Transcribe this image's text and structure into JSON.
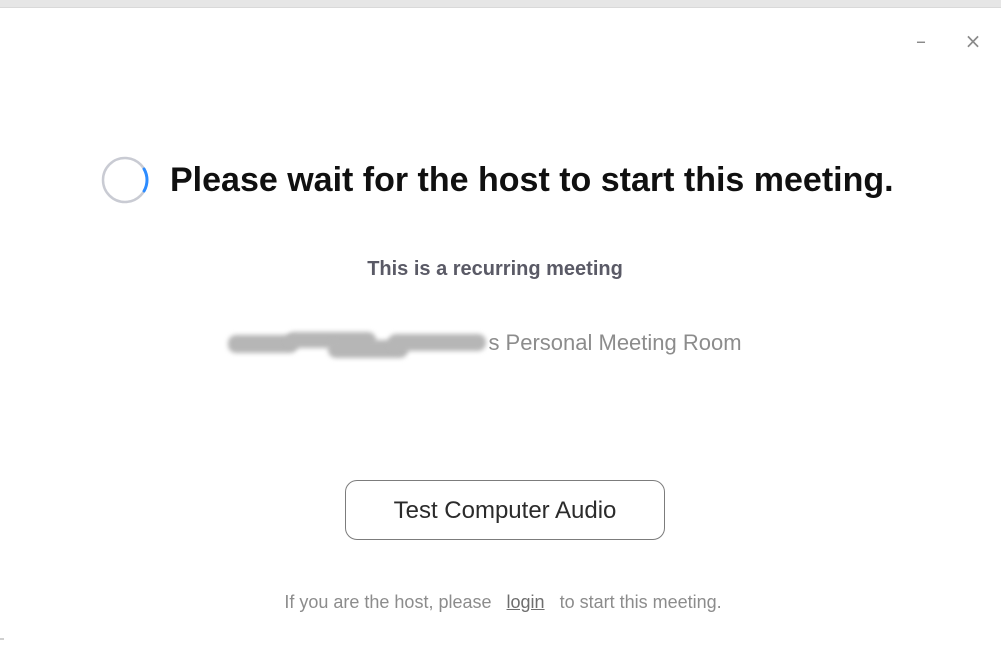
{
  "window": {
    "minimize_glyph": "–",
    "close_glyph": "×"
  },
  "main": {
    "title": "Please wait for the host to start this meeting.",
    "subtitle": "This is a recurring meeting",
    "room_name_suffix": "s Personal Meeting Room",
    "test_audio_label": "Test Computer Audio"
  },
  "footer": {
    "prefix": "If you are the host, please",
    "login_label": "login",
    "suffix": "to start this meeting."
  },
  "icons": {
    "spinner": "loading-spinner-icon",
    "minimize": "minimize-icon",
    "close": "close-icon"
  },
  "colors": {
    "spinner_track": "#c9cbd3",
    "spinner_accent": "#2d8cff",
    "title_text": "#101010",
    "muted_text": "#8c8c8c",
    "button_border": "#7c7c7c"
  }
}
